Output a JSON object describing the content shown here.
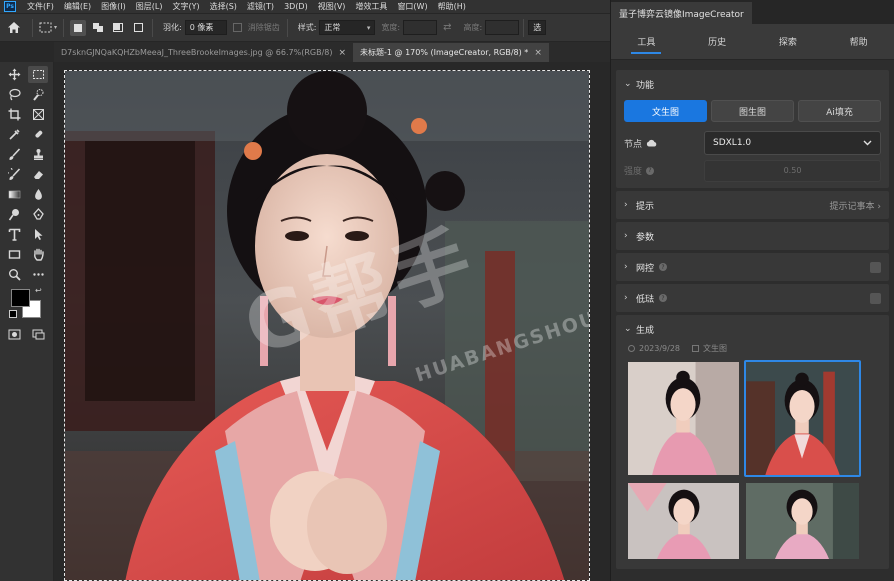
{
  "menu": {
    "logo": "Ps",
    "items": [
      "文件(F)",
      "编辑(E)",
      "图像(I)",
      "图层(L)",
      "文字(Y)",
      "选择(S)",
      "滤镜(T)",
      "3D(D)",
      "视图(V)",
      "增效工具",
      "窗口(W)",
      "帮助(H)"
    ]
  },
  "options": {
    "feather_label": "羽化:",
    "feather_value": "0 像素",
    "antialias_label": "消除锯齿",
    "style_label": "样式:",
    "style_value": "正常",
    "width_label": "宽度:",
    "height_label": "高度:",
    "select_label": "选"
  },
  "tabs": [
    {
      "label": "D7sknGJNQaKQHZbMeeaJ_ThreeBrookeImages.jpg @ 66.7%(RGB/8)",
      "close": "×"
    },
    {
      "label": "未标题-1 @ 170% (ImageCreator, RGB/8) *",
      "close": "×"
    }
  ],
  "canvas": {
    "watermark": "G帮手",
    "watermark_sub": "HUABANGSHOU.COM"
  },
  "panel": {
    "title": "量子博弈云镜像ImageCreator",
    "tabs": [
      "工具",
      "历史",
      "探索",
      "帮助"
    ],
    "function": {
      "title": "功能",
      "modes": [
        "文生图",
        "图生图",
        "Ai填充"
      ],
      "node_label": "节点",
      "node_value": "SDXL1.0",
      "strength_label": "强度",
      "strength_value": "0.50"
    },
    "prompt": {
      "title": "提示",
      "right": "提示记事本 ›"
    },
    "params": {
      "title": "参数"
    },
    "control": {
      "title": "网控"
    },
    "lowres": {
      "title": "低琺"
    },
    "generate": {
      "title": "生成",
      "date": "2023/9/28",
      "mode": "文生图"
    }
  },
  "colors": {
    "accent": "#1a77e0",
    "selection": "#2e88e6",
    "panel_bg": "#2d2d2d"
  }
}
